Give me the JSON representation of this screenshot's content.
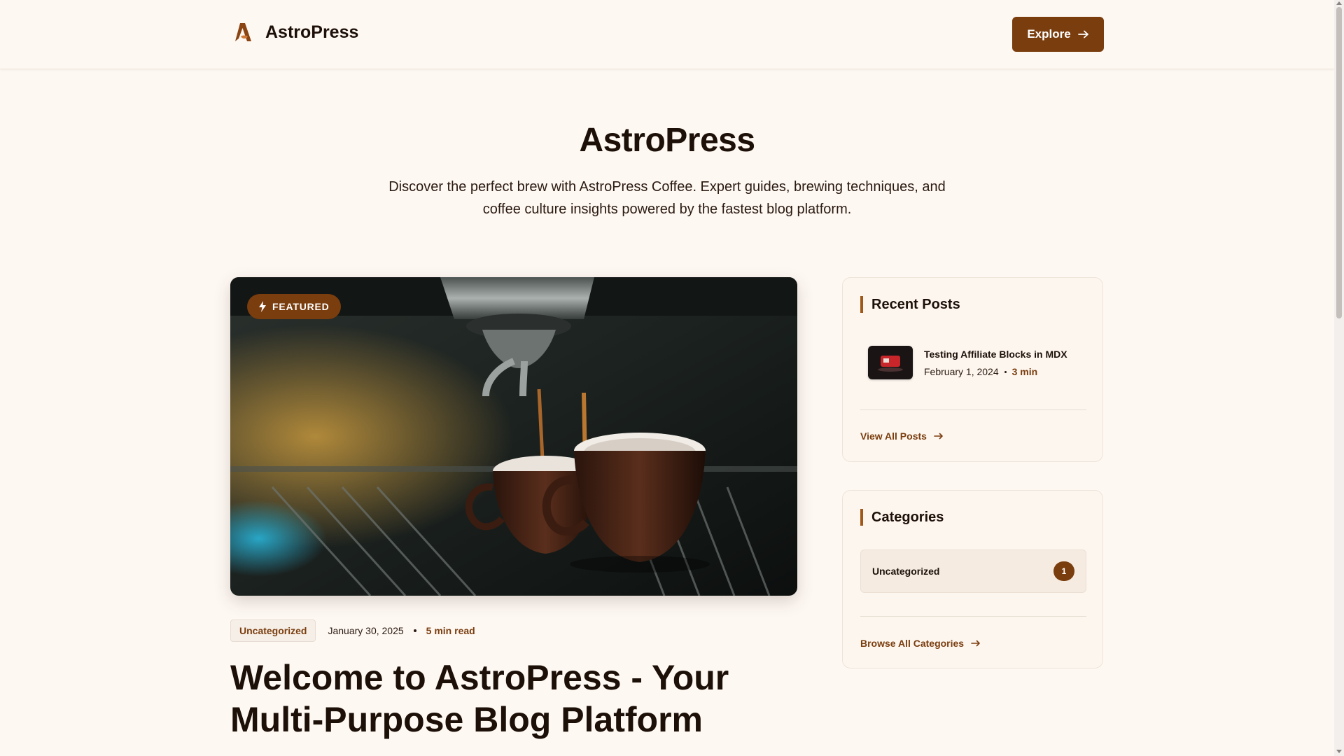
{
  "header": {
    "brand": "AstroPress",
    "explore_label": "Explore"
  },
  "hero": {
    "title": "AstroPress",
    "subtitle": "Discover the perfect brew with AstroPress Coffee. Expert guides, brewing techniques, and coffee culture insights powered by the fastest blog platform."
  },
  "featured": {
    "badge": "FEATURED",
    "category": "Uncategorized",
    "date": "January 30, 2025",
    "read_time": "5 min read",
    "title": "Welcome to AstroPress - Your Multi-Purpose Blog Platform"
  },
  "recent_posts": {
    "heading": "Recent Posts",
    "items": [
      {
        "title": "Testing Affiliate Blocks in MDX",
        "date": "February 1, 2024",
        "read_time": "3 min"
      }
    ],
    "view_all": "View All Posts"
  },
  "categories": {
    "heading": "Categories",
    "items": [
      {
        "name": "Uncategorized",
        "count": "1"
      }
    ],
    "browse_all": "Browse All Categories"
  },
  "colors": {
    "background": "#fef8f3",
    "brand": "#7a3d0e",
    "accent_bar": "#a0581a",
    "text": "#1c1008"
  },
  "icons": {
    "logo": "astro-logo-icon",
    "explore": "arrow-right-icon",
    "featured": "lightning-bolt-icon"
  }
}
